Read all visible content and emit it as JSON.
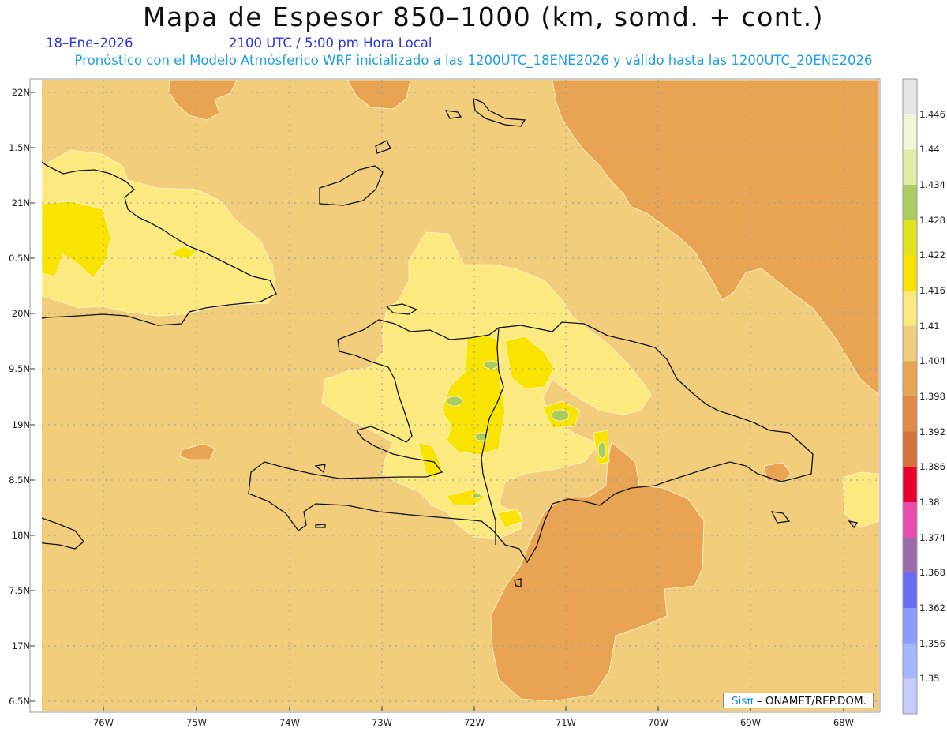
{
  "title": "Mapa de Espesor 850–1000 (km, somd. + cont.)",
  "date": "18–Ene–2026",
  "time": "2100 UTC / 5:00 pm Hora Local",
  "description": "Pronóstico con el Modelo Atmósferico WRF inicializado a las 1200UTC_18ENE2026 y válido hasta las  1200UTC_20ENE2026",
  "credit": {
    "brand": "Sisπ",
    "text": "– ONAMET/REP.DOM."
  },
  "lat_labels": [
    "22N",
    "1.5N",
    "21N",
    "0.5N",
    "20N",
    "9.5N",
    "19N",
    "8.5N",
    "18N",
    "7.5N",
    "17N",
    "6.5N"
  ],
  "lon_labels": [
    "76W",
    "75W",
    "74W",
    "73W",
    "72W",
    "71W",
    "70W",
    "69W",
    "68W"
  ],
  "colorbar": {
    "labels": [
      "1.446",
      "1.44",
      "1.434",
      "1.428",
      "1.422",
      "1.416",
      "1.41",
      "1.404",
      "1.398",
      "1.392",
      "1.386",
      "1.38",
      "1.374",
      "1.368",
      "1.362",
      "1.356",
      "1.35"
    ],
    "colors": [
      "#e6e6e6",
      "#f2f6d6",
      "#e2eea8",
      "#aacd5f",
      "#e0e41e",
      "#f8e400",
      "#fce980",
      "#f2cd7c",
      "#e8a452",
      "#e08c46",
      "#d7713c",
      "#e8002e",
      "#ea4cae",
      "#9b6dad",
      "#6a6cf5",
      "#8a9cff",
      "#a3b8ff",
      "#c6ccff"
    ]
  },
  "colors": {
    "base": "#f2cd7c",
    "light": "#fce980",
    "yellow": "#f8e400",
    "green": "#aacd5f",
    "orange": "#e8a452"
  }
}
